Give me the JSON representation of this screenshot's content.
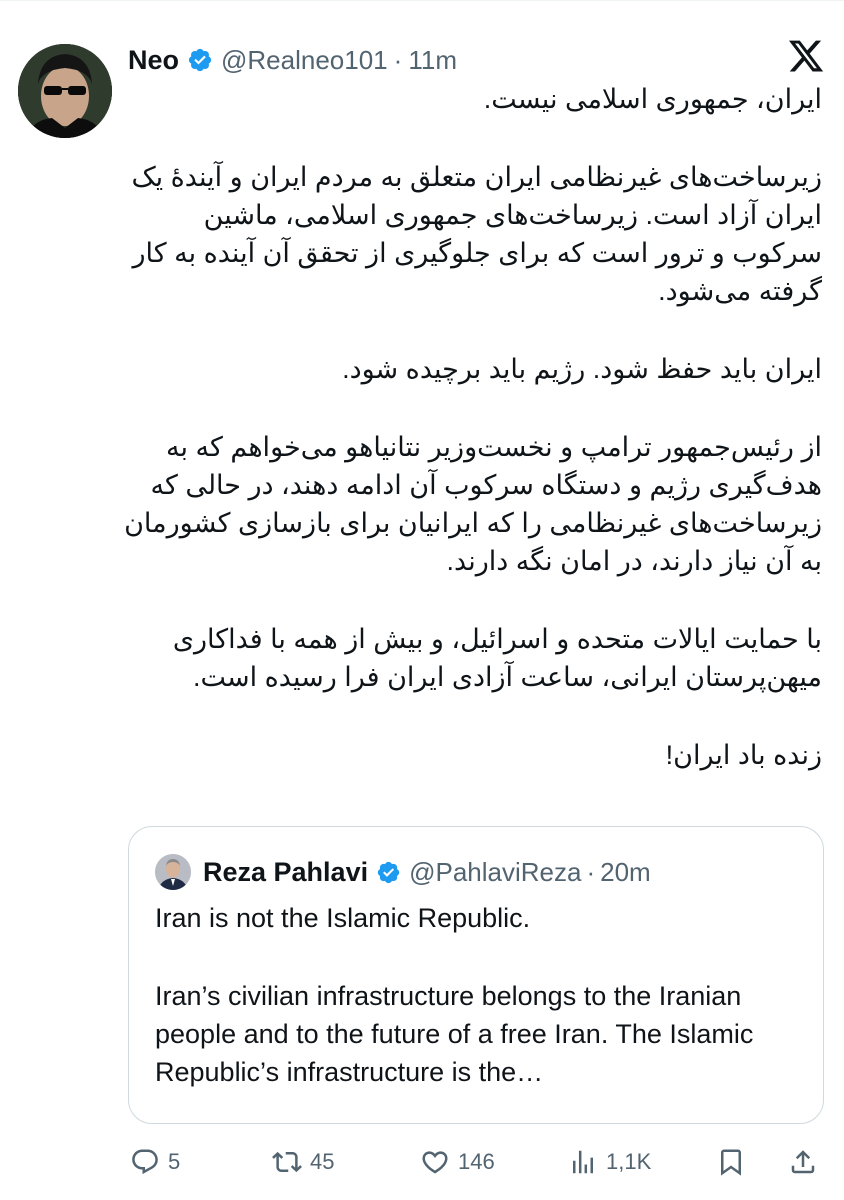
{
  "tweet": {
    "author_name": "Neo",
    "author_handle": "@Realneo101",
    "time_separator": "·",
    "time": "11m",
    "paragraphs": [
      "ایران، جمهوری اسلامی نیست.",
      "زیرساخت‌های غیرنظامی ایران متعلق به مردم ایران و آیندهٔ یک ایران آزاد است. زیرساخت‌های جمهوری اسلامی، ماشین سرکوب و ترور است که برای جلوگیری از تحقق آن آینده به کار گرفته می‌شود.",
      "ایران باید حفظ شود. رژیم باید برچیده شود.",
      "از رئیس‌جمهور ترامپ و نخست‌وزیر نتانیاهو می‌خواهم که به هدف‌گیری رژیم و دستگاه سرکوب آن ادامه دهند، در حالی که زیرساخت‌های غیرنظامی را که ایرانیان برای بازسازی کشورمان به آن نیاز دارند، در امان نگه دارند.",
      "با حمایت ایالات متحده و اسرائیل، و بیش از همه با فداکاری میهن‌پرستان ایرانی، ساعت آزادی ایران فرا رسیده است.",
      "زنده باد ایران!"
    ]
  },
  "quote": {
    "author_name": "Reza Pahlavi",
    "author_handle": "@PahlaviReza",
    "time_separator": "·",
    "time": "20m",
    "paragraphs": [
      "Iran is not the Islamic Republic.",
      "Iran’s civilian infrastructure belongs to the Iranian people and to the future of a free Iran. The Islamic Republic’s infrastructure is the…"
    ]
  },
  "actions": {
    "reply_count": "5",
    "repost_count": "45",
    "like_count": "146",
    "view_count": "1,1K"
  },
  "colors": {
    "text": "#0f1419",
    "secondary": "#536471",
    "verified": "#1d9bf0",
    "border": "#cfd9de"
  },
  "icons": [
    "verified-badge-icon",
    "x-logo-icon",
    "reply-icon",
    "repost-icon",
    "like-icon",
    "views-icon",
    "bookmark-icon",
    "share-icon"
  ]
}
